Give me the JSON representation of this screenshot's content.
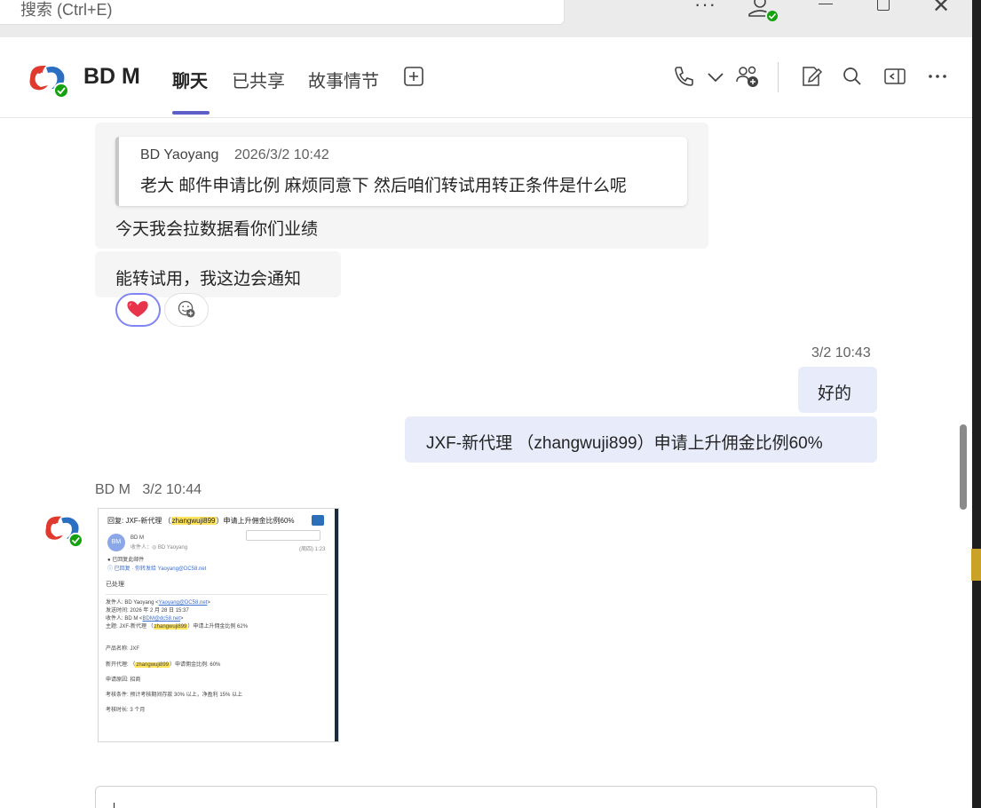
{
  "titlebar": {
    "search_placeholder": "搜索 (Ctrl+E)",
    "more_icon": "more-horizontal-icon",
    "account_icon": "person-available-icon"
  },
  "header": {
    "chat_title": "BD M",
    "tabs": [
      {
        "label": "聊天",
        "active": true
      },
      {
        "label": "已共享",
        "active": false
      },
      {
        "label": "故事情节",
        "active": false
      }
    ],
    "icons": [
      "add-tab-icon",
      "call-icon",
      "chevron-down-icon",
      "add-people-icon",
      "compose-edit-icon",
      "search-icon",
      "pop-out-icon",
      "more-options-icon"
    ]
  },
  "messages": {
    "quote": {
      "author": "BD Yaoyang",
      "time": "2026/3/2 10:42",
      "text": "老大 邮件申请比例 麻烦同意下 然后咱们转试用转正条件是什么呢"
    },
    "reply_1": "今天我会拉数据看你们业绩",
    "reply_2": "能转试用，我这边会通知",
    "reaction_icon": "heart-reaction-icon",
    "add_reaction_icon": "add-reaction-icon",
    "my_time": "3/2 10:43",
    "my_msg_1": "好的",
    "my_msg_2": "JXF-新代理 （zhangwuji899）申请上升佣金比例60%",
    "sender_name": "BD M",
    "sender_time": "3/2 10:44"
  },
  "email_thumb": {
    "subject_prefix": "回复: JXF-新代理 （",
    "subject_highlight": "zhangwuji899",
    "subject_suffix": "）申请上升佣金比例60%",
    "from_name": "BD M",
    "to_line": "收件人：◎ BD Yaoyang",
    "date_small": "(周四) 1:23",
    "reply_note": "● 已回复此邮件",
    "forward_note": "ⓘ 已回复 · 你转发给 Yaoyang@DC58.net",
    "processed": "已处理",
    "f_from_label": "发件人: BD Yaoyang <",
    "f_from_link": "Yaoyang@DC58.net",
    "f_from_end": ">",
    "f_sent": "发送时间: 2026 年 2 月 28 日 15:37",
    "f_to_label": "收件人: BD M <",
    "f_to_link": "BDM@dc58.net",
    "f_to_end": ">",
    "f_subject_label": "主题: JXF-新代理 （",
    "f_subject_hl": "zhangwuji899",
    "f_subject_end": "）申请上升佣金比例 62%",
    "b_product": "产品名称: JXF",
    "b_agent_label": "新开代理: （",
    "b_agent_hl": "zhangwuji899",
    "b_agent_end": "）申请佣金比例: 60%",
    "b_reason": "申请原因: 招商",
    "b_condition": "考核条件: 预计考核期间存款 30% 以上，净盈利 15% 以上",
    "b_duration": "考核时长: 3 个月"
  },
  "colors": {
    "accent": "#5b5fc7",
    "my_bubble": "#e8ebfa",
    "other_bubble": "#f5f5f5",
    "presence_green": "#13a10e"
  }
}
